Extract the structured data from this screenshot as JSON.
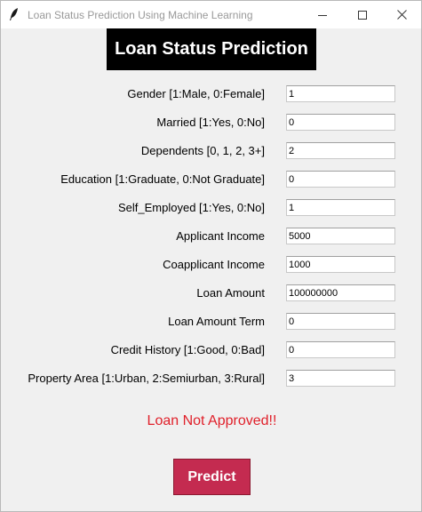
{
  "window": {
    "title": "Loan Status Prediction Using Machine Learning",
    "icon": "feather-icon"
  },
  "heading": "Loan Status Prediction",
  "fields": [
    {
      "label": "Gender [1:Male, 0:Female]",
      "value": "1"
    },
    {
      "label": "Married [1:Yes, 0:No]",
      "value": "0"
    },
    {
      "label": "Dependents [0, 1, 2, 3+]",
      "value": "2"
    },
    {
      "label": "Education [1:Graduate, 0:Not Graduate]",
      "value": "0"
    },
    {
      "label": "Self_Employed [1:Yes, 0:No]",
      "value": "1"
    },
    {
      "label": "Applicant Income",
      "value": "5000"
    },
    {
      "label": "Coapplicant Income",
      "value": "1000"
    },
    {
      "label": "Loan Amount",
      "value": "100000000"
    },
    {
      "label": "Loan Amount Term",
      "value": "0"
    },
    {
      "label": "Credit History [1:Good, 0:Bad]",
      "value": "0"
    },
    {
      "label": "Property Area [1:Urban, 2:Semiurban, 3:Rural]",
      "value": "3"
    }
  ],
  "result": "Loan Not Approved!!",
  "predict_label": "Predict",
  "colors": {
    "result": "#e0202a",
    "predict_button": "#c42b50",
    "heading_bg": "#000000"
  }
}
